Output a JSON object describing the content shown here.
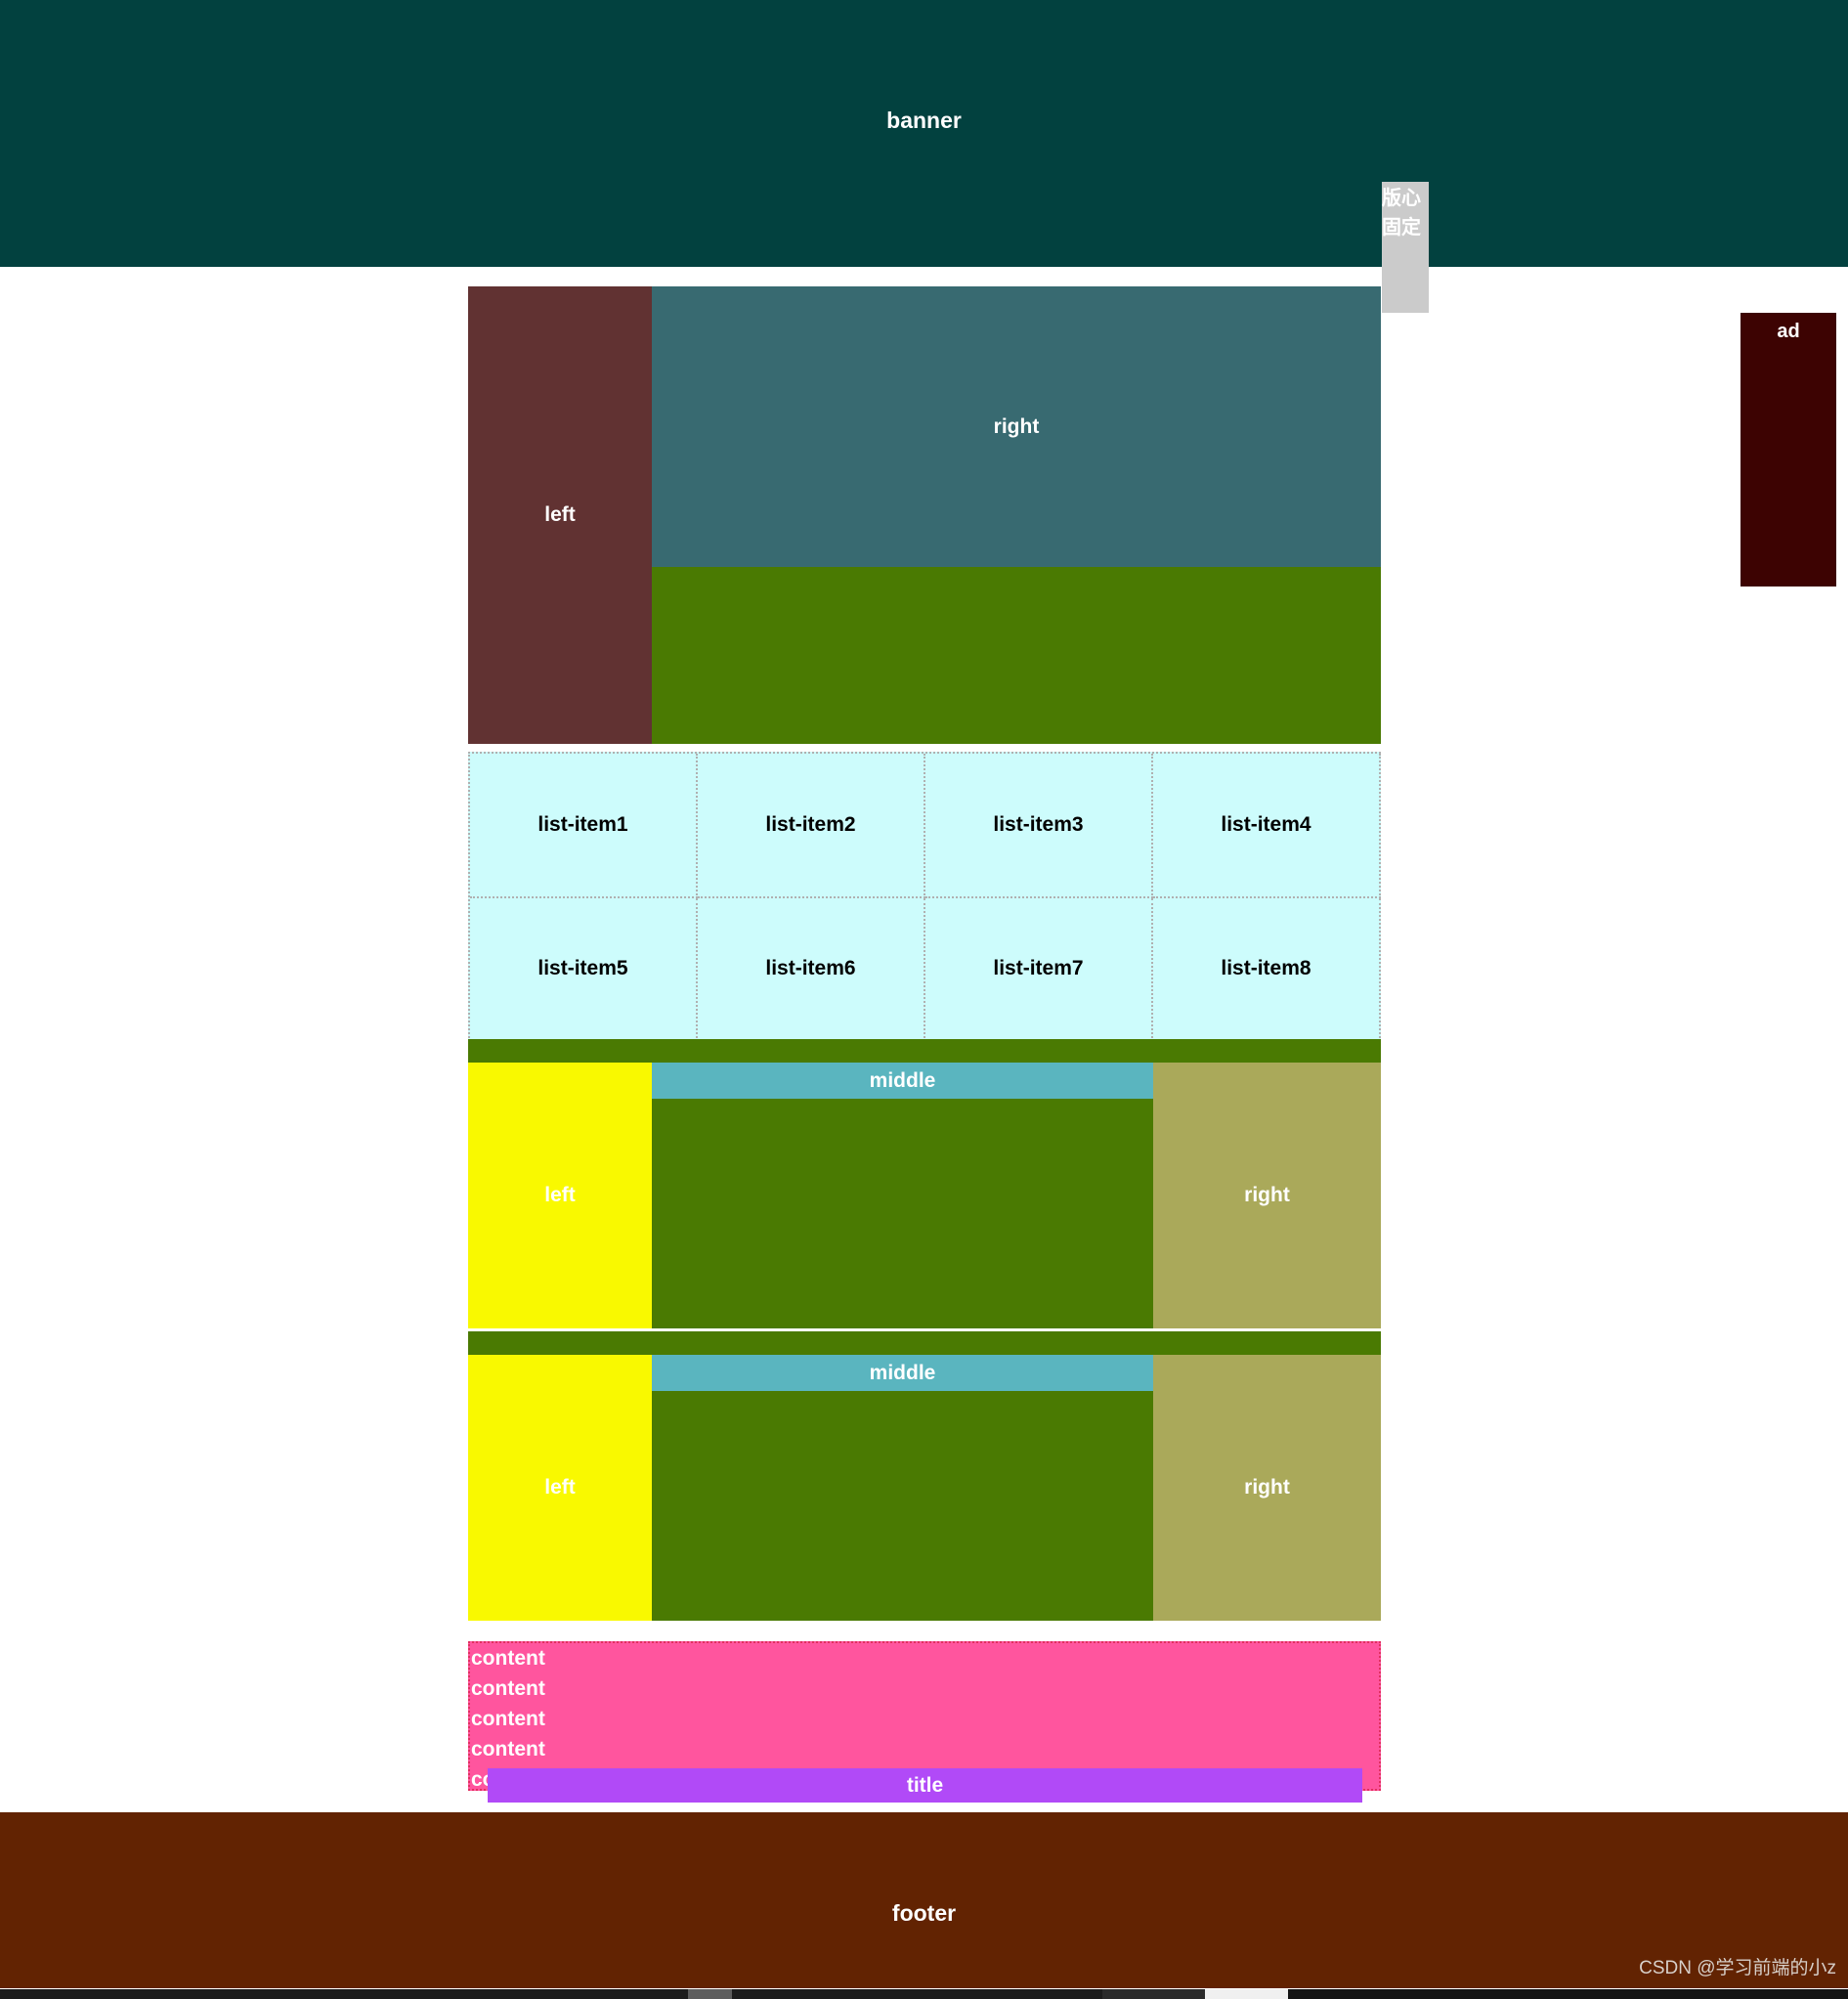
{
  "banner": {
    "label": "banner"
  },
  "fixed_center": {
    "line1": "版心",
    "line2": "固定"
  },
  "ad": {
    "label": "ad"
  },
  "section_one": {
    "left_label": "left",
    "right_label": "right"
  },
  "list": {
    "items": [
      {
        "label": "list-item1"
      },
      {
        "label": "list-item2"
      },
      {
        "label": "list-item3"
      },
      {
        "label": "list-item4"
      },
      {
        "label": "list-item5"
      },
      {
        "label": "list-item6"
      },
      {
        "label": "list-item7"
      },
      {
        "label": "list-item8"
      }
    ]
  },
  "holy_grail": [
    {
      "left_label": "left",
      "middle_label": "middle",
      "right_label": "right"
    },
    {
      "left_label": "left",
      "middle_label": "middle",
      "right_label": "right"
    }
  ],
  "content": {
    "lines": [
      "content",
      "content",
      "content",
      "content",
      "content"
    ]
  },
  "title_bar": {
    "label": "title"
  },
  "footer": {
    "label": "footer"
  },
  "watermark": {
    "text": "CSDN @学习前端的小z"
  },
  "colors": {
    "banner_bg": "#02413f",
    "ad_bg": "#3d0302",
    "left_bg": "#613232",
    "right_bg": "#386a71",
    "green_bg": "#4a7a02",
    "list_bg": "#cdfcfc",
    "hg_left_bg": "#f9f900",
    "hg_mid_bg": "#5ab5bf",
    "hg_right_bg": "#aaa95a",
    "content_bg": "#ff559e",
    "title_bg": "#b14af7",
    "footer_bg": "#622302",
    "fixed_center_bg": "#cbcbcb"
  }
}
